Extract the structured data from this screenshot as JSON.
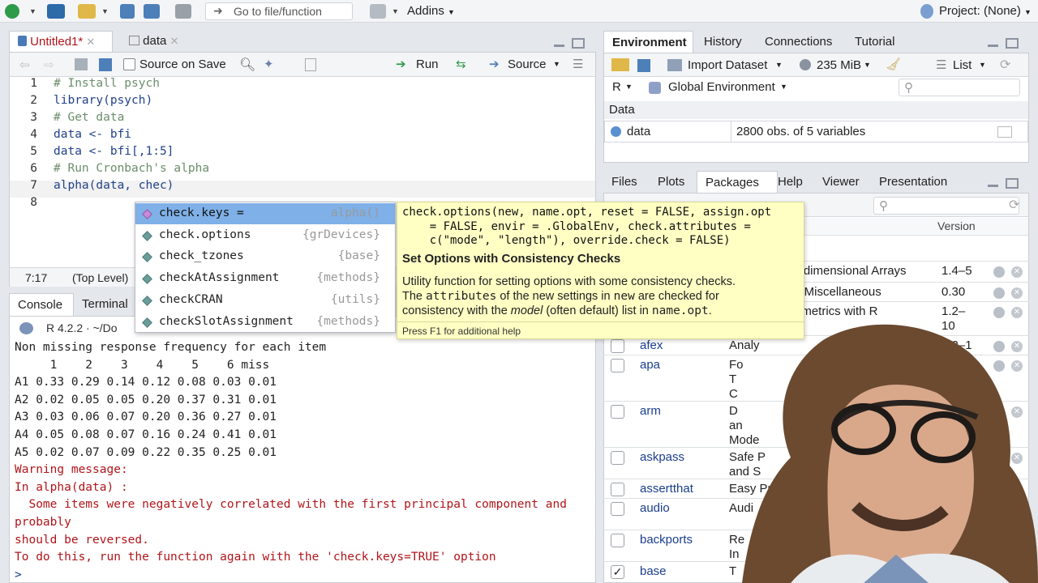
{
  "toolbar": {
    "goto_placeholder": "Go to file/function",
    "addins_label": "Addins",
    "project_label": "Project: (None)"
  },
  "editor": {
    "tabs": [
      {
        "label": "Untitled1*"
      },
      {
        "label": "data"
      }
    ],
    "source_on_save": "Source on Save",
    "run_label": "Run",
    "source_label": "Source",
    "lines": [
      {
        "n": "1",
        "text": "# Install psych"
      },
      {
        "n": "2",
        "text": "library(psych)"
      },
      {
        "n": "3",
        "text": "# Get data"
      },
      {
        "n": "4",
        "text": "data <- bfi"
      },
      {
        "n": "5",
        "text": "data <- bfi[,1:5]"
      },
      {
        "n": "6",
        "text": "# Run Cronbach's alpha"
      },
      {
        "n": "7",
        "text": "alpha(data, chec)"
      },
      {
        "n": "8",
        "text": ""
      }
    ],
    "status_position": "7:17",
    "status_scope": "(Top Level)"
  },
  "autocomplete": {
    "items": [
      {
        "name": "check.keys =",
        "pkg": "alpha()"
      },
      {
        "name": "check.options",
        "pkg": "{grDevices}"
      },
      {
        "name": "check_tzones",
        "pkg": "{base}"
      },
      {
        "name": "checkAtAssignment",
        "pkg": "{methods}"
      },
      {
        "name": "checkCRAN",
        "pkg": "{utils}"
      },
      {
        "name": "checkSlotAssignment",
        "pkg": "{methods}"
      }
    ]
  },
  "tooltip": {
    "signature": "check.options(new, name.opt, reset = FALSE, assign.opt\n    = FALSE, envir = .GlobalEnv, check.attributes =\n    c(\"mode\", \"length\"), override.check = FALSE)",
    "title": "Set Options with Consistency Checks",
    "desc_1": "Utility function for setting options with some consistency checks.",
    "desc_2a": "The ",
    "desc_2b": "attributes",
    "desc_2c": " of the new settings in ",
    "desc_2d": "new",
    "desc_2e": " are checked for",
    "desc_3a": "consistency with the ",
    "desc_3b": "model",
    "desc_3c": " (often default) list in ",
    "desc_3d": "name.opt",
    "desc_3e": ".",
    "help_hint": "Press F1 for additional help"
  },
  "console": {
    "tabs": [
      {
        "label": "Console"
      },
      {
        "label": "Terminal"
      }
    ],
    "r_version": "R 4.2.2 · ~/Do",
    "lines": [
      {
        "text": "Non missing response frequency for each item",
        "cls": ""
      },
      {
        "text": "     1    2    3    4    5    6 miss",
        "cls": ""
      },
      {
        "text": "A1 0.33 0.29 0.14 0.12 0.08 0.03 0.01",
        "cls": ""
      },
      {
        "text": "A2 0.02 0.05 0.05 0.20 0.37 0.31 0.01",
        "cls": ""
      },
      {
        "text": "A3 0.03 0.06 0.07 0.20 0.36 0.27 0.01",
        "cls": ""
      },
      {
        "text": "A4 0.05 0.08 0.07 0.16 0.24 0.41 0.01",
        "cls": ""
      },
      {
        "text": "A5 0.02 0.07 0.09 0.22 0.35 0.25 0.01",
        "cls": ""
      },
      {
        "text": "Warning message:",
        "cls": "red"
      },
      {
        "text": "In alpha(data) :",
        "cls": "red"
      },
      {
        "text": "  Some items were negatively correlated with the first principal component and",
        "cls": "red"
      },
      {
        "text": "probably",
        "cls": "red"
      },
      {
        "text": "should be reversed.",
        "cls": "red"
      },
      {
        "text": "To do this, run the function again with the 'check.keys=TRUE' option",
        "cls": "red"
      }
    ],
    "prompt": ">"
  },
  "environment": {
    "tabs": [
      {
        "label": "Environment"
      },
      {
        "label": "History"
      },
      {
        "label": "Connections"
      },
      {
        "label": "Tutorial"
      }
    ],
    "import_dataset": "Import Dataset",
    "memory": "235 MiB",
    "list_label": "List",
    "lang": "R",
    "scope": "Global Environment",
    "section": "Data",
    "rows": [
      {
        "name": "data",
        "value": "2800 obs. of 5 variables"
      }
    ]
  },
  "files": {
    "tabs": [
      {
        "label": "Files"
      },
      {
        "label": "Plots"
      },
      {
        "label": "Packages"
      },
      {
        "label": "Help"
      },
      {
        "label": "Viewer"
      },
      {
        "label": "Presentation"
      }
    ],
    "version_header": "Version",
    "packages": [
      {
        "name": "",
        "desc": "ltidimensional Arrays",
        "version": "1.4–5",
        "checked": false
      },
      {
        "name": "",
        "desc": "s Miscellaneous",
        "version": "0.30",
        "checked": false
      },
      {
        "name": "",
        "desc": "ometrics with R",
        "version": "1.2–\n10",
        "checked": false
      },
      {
        "name": "afex",
        "desc": "Analy",
        "version": "1.2–1",
        "checked": false
      },
      {
        "name": "apa",
        "desc": "Fo\nT\nC",
        "version": "0.3.3",
        "checked": false
      },
      {
        "name": "arm",
        "desc": "D\nan\nMode",
        "version": "1.13–\n1",
        "checked": false
      },
      {
        "name": "askpass",
        "desc": "Safe P\nand S",
        "version": "1.1",
        "checked": false
      },
      {
        "name": "assertthat",
        "desc": "Easy Pre",
        "version": "",
        "checked": false
      },
      {
        "name": "audio",
        "desc": "Audi",
        "version": "",
        "checked": false
      },
      {
        "name": "backports",
        "desc": "Re\nIn",
        "version": "",
        "checked": false
      },
      {
        "name": "base",
        "desc": "T",
        "version": "",
        "checked": true
      }
    ],
    "tail_text": "eriments"
  },
  "colors": {
    "accent": "#7fb0e8",
    "tooltip_bg": "#ffffc4",
    "error": "#b0151a"
  }
}
